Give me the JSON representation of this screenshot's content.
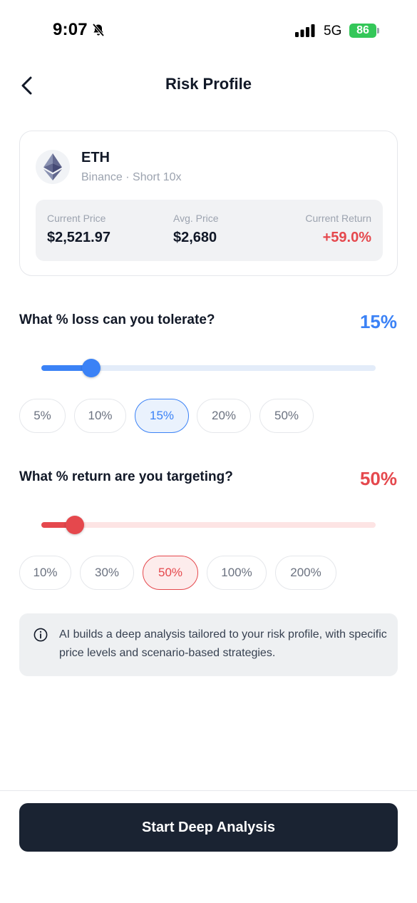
{
  "status_bar": {
    "time": "9:07",
    "network": "5G",
    "battery": "86",
    "battery_color": "#34c759"
  },
  "header": {
    "title": "Risk Profile",
    "back_icon": "chevron-left-icon"
  },
  "position": {
    "symbol": "ETH",
    "meta": "Binance · Short 10x",
    "icon": "ethereum-icon",
    "current_price_label": "Current Price",
    "current_price": "$2,521.97",
    "avg_price_label": "Avg. Price",
    "avg_price": "$2,680",
    "return_label": "Current Return",
    "return_value": "+59.0%"
  },
  "loss": {
    "question": "What % loss can you tolerate?",
    "value": "15%",
    "slider_fraction": 0.15,
    "accent": "#3b82f6",
    "track": "#e3ecf9",
    "options": [
      "5%",
      "10%",
      "15%",
      "20%",
      "50%"
    ],
    "selected": "15%"
  },
  "target": {
    "question": "What % return are you targeting?",
    "value": "50%",
    "slider_fraction": 0.1,
    "accent": "#e5484d",
    "track": "#fde4e4",
    "options": [
      "10%",
      "30%",
      "50%",
      "100%",
      "200%"
    ],
    "selected": "50%"
  },
  "info": {
    "icon": "info-icon",
    "text": "AI builds a deep analysis tailored to your risk profile, with specific price levels and scenario-based strategies."
  },
  "cta": {
    "label": "Start Deep Analysis"
  }
}
